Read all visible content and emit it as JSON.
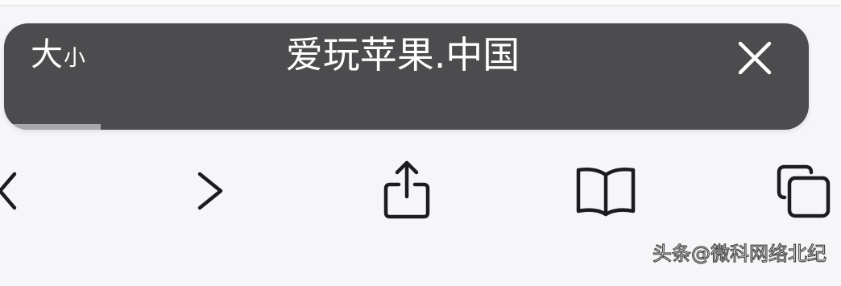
{
  "address_bar": {
    "size_label_large": "大",
    "size_label_small": "小",
    "title": "爱玩苹果.中国",
    "close_icon": "close-icon",
    "load_progress": 0.12
  },
  "toolbar": {
    "back_icon": "chevron-left-icon",
    "forward_icon": "chevron-right-icon",
    "share_icon": "share-icon",
    "bookmarks_icon": "book-icon",
    "tabs_icon": "tabs-icon"
  },
  "watermark": {
    "text": "头条@微科网络北纪"
  },
  "colors": {
    "bar_background": "#4c4c4e",
    "page_background": "#f6f6f8",
    "icon_color": "#1c1c1e",
    "progress_fill": "#a8a8ab"
  }
}
